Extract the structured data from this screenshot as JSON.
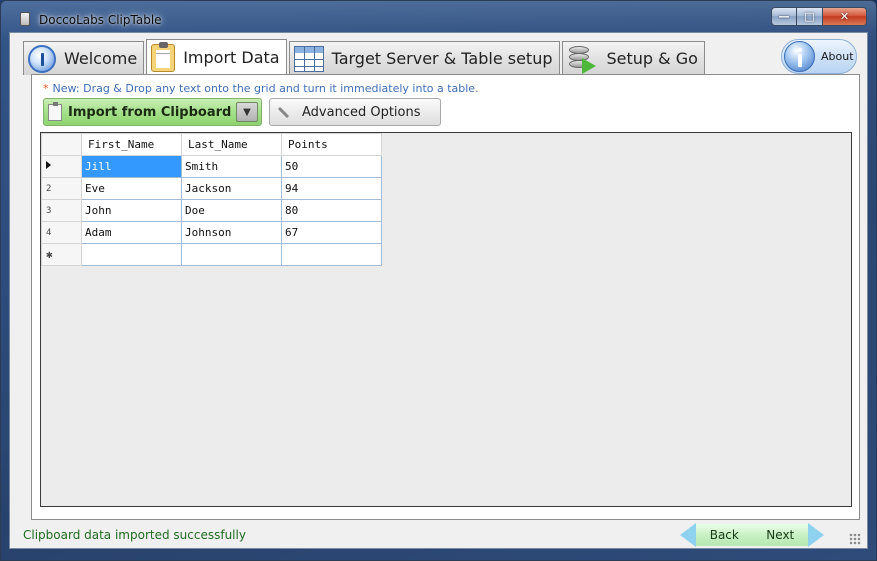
{
  "window": {
    "title": "DoccoLabs ClipTable",
    "controls": {
      "minimize_icon": "minimize-icon",
      "maximize_icon": "maximize-icon",
      "close_icon": "close-icon"
    }
  },
  "tabs": [
    {
      "label": "Welcome",
      "icon": "info-circle-icon",
      "active": false
    },
    {
      "label": "Import Data",
      "icon": "clipboard-icon",
      "active": true
    },
    {
      "label": "Target Server & Table setup",
      "icon": "table-icon",
      "active": false
    },
    {
      "label": "Setup & Go",
      "icon": "database-arrow-icon",
      "active": false
    }
  ],
  "about": {
    "label": "About",
    "icon": "info-icon"
  },
  "hint": {
    "star": "*",
    "text": "New: Drag & Drop any text onto the grid and turn it immediately into a table."
  },
  "toolbar": {
    "import_label": "Import from Clipboard",
    "advanced_label": "Advanced Options"
  },
  "grid": {
    "columns": [
      "First_Name",
      "Last_Name",
      "Points"
    ],
    "rows": [
      {
        "num": "",
        "cells": [
          "Jill",
          "Smith",
          "50"
        ]
      },
      {
        "num": "2",
        "cells": [
          "Eve",
          "Jackson",
          "94"
        ]
      },
      {
        "num": "3",
        "cells": [
          "John",
          "Doe",
          "80"
        ]
      },
      {
        "num": "4",
        "cells": [
          "Adam",
          "Johnson",
          "67"
        ]
      }
    ],
    "new_row_marker": "✱"
  },
  "status": {
    "message": "Clipboard data imported successfully"
  },
  "nav": {
    "back_label": "Back",
    "next_label": "Next"
  },
  "colors": {
    "accent_green": "#8ed46f",
    "selection": "#3399ff",
    "hint": "#3f6fb5",
    "status": "#1f6b1f"
  }
}
